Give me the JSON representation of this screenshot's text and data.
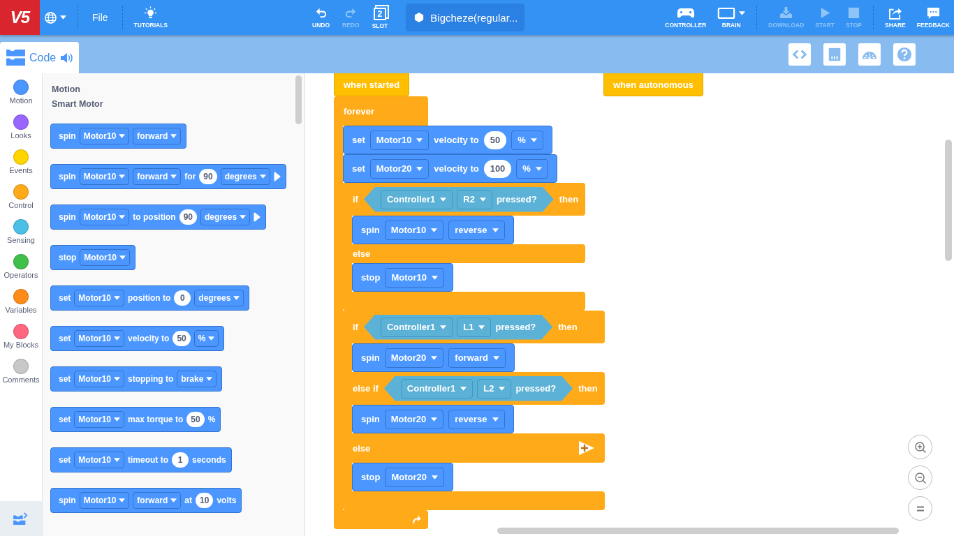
{
  "toolbar": {
    "logo": "V5",
    "left": [
      {
        "kind": "language"
      },
      {
        "kind": "file",
        "label": "File"
      },
      {
        "kind": "tutorials",
        "label": "TUTORIALS"
      }
    ],
    "center": [
      {
        "kind": "undo",
        "label": "UNDO",
        "disabled": false
      },
      {
        "kind": "redo",
        "label": "REDO",
        "disabled": true
      },
      {
        "kind": "slot",
        "label": "SLOT",
        "number": "2",
        "disabled": false
      }
    ],
    "project": {
      "name": "Bigcheze(regular..."
    },
    "right_groups": [
      [
        {
          "kind": "controller",
          "label": "CONTROLLER",
          "disabled": false
        },
        {
          "kind": "brain",
          "label": "BRAIN",
          "disabled": false
        }
      ],
      [
        {
          "kind": "download",
          "label": "DOWNLOAD",
          "disabled": true
        },
        {
          "kind": "start",
          "label": "START",
          "disabled": true
        },
        {
          "kind": "stop",
          "label": "STOP",
          "disabled": true
        }
      ],
      [
        {
          "kind": "share",
          "label": "SHARE",
          "disabled": false
        },
        {
          "kind": "feedback",
          "label": "FEEDBACK",
          "disabled": false
        }
      ]
    ]
  },
  "code_tab": {
    "label": "Code"
  },
  "categories": [
    {
      "name": "Motion",
      "color": "#4c97ff"
    },
    {
      "name": "Looks",
      "color": "#9966ff"
    },
    {
      "name": "Events",
      "color": "#ffd500"
    },
    {
      "name": "Control",
      "color": "#ffab19"
    },
    {
      "name": "Sensing",
      "color": "#4cbfe6"
    },
    {
      "name": "Operators",
      "color": "#40bf4a"
    },
    {
      "name": "Variables",
      "color": "#ff8c1a"
    },
    {
      "name": "My Blocks",
      "color": "#ff6680"
    },
    {
      "name": "Comments",
      "color": "#c8c8c8"
    }
  ],
  "palette": {
    "title": "Motion",
    "subtitle": "Smart Motor",
    "blocks": [
      {
        "parts": [
          {
            "kind": "label",
            "text": "spin"
          },
          {
            "kind": "dropdown",
            "text": "Motor10"
          },
          {
            "kind": "dropdown",
            "text": "forward"
          }
        ]
      },
      {
        "parts": [
          {
            "kind": "label",
            "text": "spin"
          },
          {
            "kind": "dropdown",
            "text": "Motor10"
          },
          {
            "kind": "dropdown",
            "text": "forward"
          },
          {
            "kind": "label",
            "text": "for"
          },
          {
            "kind": "number",
            "text": "90"
          },
          {
            "kind": "dropdown",
            "text": "degrees"
          },
          {
            "kind": "arrow"
          }
        ]
      },
      {
        "parts": [
          {
            "kind": "label",
            "text": "spin"
          },
          {
            "kind": "dropdown",
            "text": "Motor10"
          },
          {
            "kind": "label",
            "text": "to position"
          },
          {
            "kind": "number",
            "text": "90"
          },
          {
            "kind": "dropdown",
            "text": "degrees"
          },
          {
            "kind": "arrow"
          }
        ]
      },
      {
        "parts": [
          {
            "kind": "label",
            "text": "stop"
          },
          {
            "kind": "dropdown",
            "text": "Motor10"
          }
        ]
      },
      {
        "parts": [
          {
            "kind": "label",
            "text": "set"
          },
          {
            "kind": "dropdown",
            "text": "Motor10"
          },
          {
            "kind": "label",
            "text": "position to"
          },
          {
            "kind": "number",
            "text": "0"
          },
          {
            "kind": "dropdown",
            "text": "degrees"
          }
        ]
      },
      {
        "parts": [
          {
            "kind": "label",
            "text": "set"
          },
          {
            "kind": "dropdown",
            "text": "Motor10"
          },
          {
            "kind": "label",
            "text": "velocity to"
          },
          {
            "kind": "number",
            "text": "50"
          },
          {
            "kind": "dropdown",
            "text": "%"
          }
        ]
      },
      {
        "parts": [
          {
            "kind": "label",
            "text": "set"
          },
          {
            "kind": "dropdown",
            "text": "Motor10"
          },
          {
            "kind": "label",
            "text": "stopping to"
          },
          {
            "kind": "dropdown",
            "text": "brake"
          }
        ]
      },
      {
        "parts": [
          {
            "kind": "label",
            "text": "set"
          },
          {
            "kind": "dropdown",
            "text": "Motor10"
          },
          {
            "kind": "label",
            "text": "max torque to"
          },
          {
            "kind": "number",
            "text": "50"
          },
          {
            "kind": "label",
            "text": "%"
          }
        ]
      },
      {
        "parts": [
          {
            "kind": "label",
            "text": "set"
          },
          {
            "kind": "dropdown",
            "text": "Motor10"
          },
          {
            "kind": "label",
            "text": "timeout to"
          },
          {
            "kind": "number",
            "text": "1"
          },
          {
            "kind": "label",
            "text": "seconds"
          }
        ]
      },
      {
        "parts": [
          {
            "kind": "label",
            "text": "spin"
          },
          {
            "kind": "dropdown",
            "text": "Motor10"
          },
          {
            "kind": "dropdown",
            "text": "forward"
          },
          {
            "kind": "label",
            "text": "at"
          },
          {
            "kind": "number",
            "text": "10"
          },
          {
            "kind": "label",
            "text": "volts"
          }
        ]
      }
    ]
  },
  "workspace": {
    "scripts": [
      {
        "hat": {
          "text": "when started"
        },
        "stack": [
          {
            "kind": "forever",
            "label": "forever",
            "body": [
              {
                "kind": "stack",
                "parts": [
                  {
                    "kind": "label",
                    "text": "set"
                  },
                  {
                    "kind": "dropdown",
                    "text": "Motor10"
                  },
                  {
                    "kind": "label",
                    "text": "velocity to"
                  },
                  {
                    "kind": "number",
                    "text": "50"
                  },
                  {
                    "kind": "dropdown",
                    "text": "%"
                  }
                ]
              },
              {
                "kind": "stack",
                "parts": [
                  {
                    "kind": "label",
                    "text": "set"
                  },
                  {
                    "kind": "dropdown",
                    "text": "Motor20"
                  },
                  {
                    "kind": "label",
                    "text": "velocity to"
                  },
                  {
                    "kind": "number",
                    "text": "100"
                  },
                  {
                    "kind": "dropdown",
                    "text": "%"
                  }
                ]
              },
              {
                "kind": "if",
                "clauses": [
                  {
                    "add_button": false,
                    "parts": [
                      {
                        "kind": "label",
                        "text": "if"
                      },
                      {
                        "kind": "sensor",
                        "parts": [
                          {
                            "kind": "dropdown",
                            "text": "Controller1"
                          },
                          {
                            "kind": "dropdown",
                            "text": "R2"
                          },
                          {
                            "kind": "label",
                            "text": "pressed?"
                          }
                        ]
                      },
                      {
                        "kind": "label",
                        "text": "then"
                      }
                    ],
                    "body": [
                      {
                        "kind": "stack",
                        "parts": [
                          {
                            "kind": "label",
                            "text": "spin"
                          },
                          {
                            "kind": "dropdown",
                            "text": "Motor10"
                          },
                          {
                            "kind": "dropdown",
                            "text": "reverse"
                          }
                        ]
                      }
                    ]
                  },
                  {
                    "add_button": false,
                    "parts": [
                      {
                        "kind": "label",
                        "text": "else"
                      }
                    ],
                    "body": [
                      {
                        "kind": "stack",
                        "parts": [
                          {
                            "kind": "label",
                            "text": "stop"
                          },
                          {
                            "kind": "dropdown",
                            "text": "Motor10"
                          }
                        ]
                      }
                    ]
                  }
                ]
              },
              {
                "kind": "if",
                "clauses": [
                  {
                    "add_button": false,
                    "parts": [
                      {
                        "kind": "label",
                        "text": "if"
                      },
                      {
                        "kind": "sensor",
                        "parts": [
                          {
                            "kind": "dropdown",
                            "text": "Controller1"
                          },
                          {
                            "kind": "dropdown",
                            "text": "L1"
                          },
                          {
                            "kind": "label",
                            "text": "pressed?"
                          }
                        ]
                      },
                      {
                        "kind": "label",
                        "text": "then"
                      }
                    ],
                    "body": [
                      {
                        "kind": "stack",
                        "parts": [
                          {
                            "kind": "label",
                            "text": "spin"
                          },
                          {
                            "kind": "dropdown",
                            "text": "Motor20"
                          },
                          {
                            "kind": "dropdown",
                            "text": "forward"
                          }
                        ]
                      }
                    ]
                  },
                  {
                    "add_button": false,
                    "parts": [
                      {
                        "kind": "label",
                        "text": "else if"
                      },
                      {
                        "kind": "sensor",
                        "parts": [
                          {
                            "kind": "dropdown",
                            "text": "Controller1"
                          },
                          {
                            "kind": "dropdown",
                            "text": "L2"
                          },
                          {
                            "kind": "label",
                            "text": "pressed?"
                          }
                        ]
                      },
                      {
                        "kind": "label",
                        "text": "then"
                      }
                    ],
                    "body": [
                      {
                        "kind": "stack",
                        "parts": [
                          {
                            "kind": "label",
                            "text": "spin"
                          },
                          {
                            "kind": "dropdown",
                            "text": "Motor20"
                          },
                          {
                            "kind": "dropdown",
                            "text": "reverse"
                          }
                        ]
                      }
                    ]
                  },
                  {
                    "add_button": true,
                    "parts": [
                      {
                        "kind": "label",
                        "text": "else"
                      }
                    ],
                    "body": [
                      {
                        "kind": "stack",
                        "parts": [
                          {
                            "kind": "label",
                            "text": "stop"
                          },
                          {
                            "kind": "dropdown",
                            "text": "Motor20"
                          }
                        ]
                      }
                    ]
                  }
                ]
              }
            ]
          }
        ]
      },
      {
        "hat": {
          "text": "when autonomous"
        }
      }
    ]
  }
}
